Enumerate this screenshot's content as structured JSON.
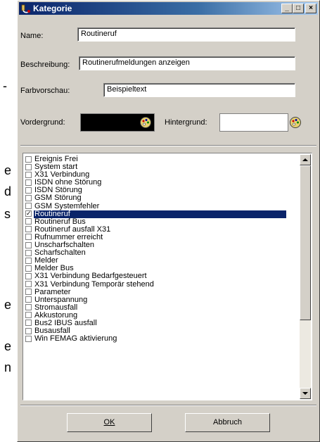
{
  "background_text": {
    "letters": [
      "-",
      "e",
      "d",
      "s",
      "e",
      "e",
      "n"
    ]
  },
  "window": {
    "title": "Kategorie",
    "controls": {
      "minimize": "_",
      "maximize": "□",
      "close": "×"
    }
  },
  "form": {
    "name_label": "Name:",
    "name_value": "Routineruf",
    "description_label": "Beschreibung:",
    "description_value": "Routinerufmeldungen anzeigen",
    "preview_label": "Farbvorschau:",
    "preview_value": "Beispieltext",
    "foreground_label": "Vordergrund:",
    "foreground_color": "#000000",
    "background_label": "Hintergrund:",
    "background_color": "#ffffff"
  },
  "list": {
    "items": [
      {
        "label": "Ereignis Frei",
        "checked": false
      },
      {
        "label": "System start",
        "checked": false
      },
      {
        "label": "X31 Verbindung",
        "checked": false
      },
      {
        "label": "ISDN ohne Störung",
        "checked": false
      },
      {
        "label": "ISDN Störung",
        "checked": false
      },
      {
        "label": "GSM Störung",
        "checked": false
      },
      {
        "label": "GSM Systemfehler",
        "checked": false
      },
      {
        "label": "Routineruf",
        "checked": true,
        "selected": true
      },
      {
        "label": "Routineruf Bus",
        "checked": false
      },
      {
        "label": "Routineruf ausfall X31",
        "checked": false
      },
      {
        "label": "Rufnummer erreicht",
        "checked": false
      },
      {
        "label": "Unscharfschalten",
        "checked": false
      },
      {
        "label": "Scharfschalten",
        "checked": false
      },
      {
        "label": "Melder",
        "checked": false
      },
      {
        "label": "Melder Bus",
        "checked": false
      },
      {
        "label": "X31 Verbindung Bedarfgesteuert",
        "checked": false
      },
      {
        "label": "X31 Verbindung Temporär stehend",
        "checked": false
      },
      {
        "label": "Parameter",
        "checked": false
      },
      {
        "label": "Unterspannung",
        "checked": false
      },
      {
        "label": "Stromausfall",
        "checked": false
      },
      {
        "label": "Akkustorung",
        "checked": false
      },
      {
        "label": "Bus2 IBUS ausfall",
        "checked": false
      },
      {
        "label": "Busausfall",
        "checked": false
      },
      {
        "label": "Win FEMAG aktivierung",
        "checked": false
      }
    ],
    "scroll_position": 0
  },
  "buttons": {
    "ok_label": "OK",
    "cancel_label": "Abbruch"
  },
  "colors": {
    "accent": "#0a246a",
    "dialog": "#d4d0c8"
  }
}
